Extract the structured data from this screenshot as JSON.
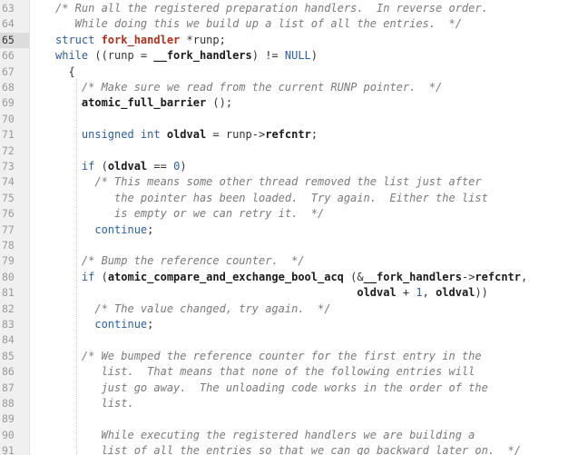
{
  "editor": {
    "lines": [
      {
        "num": "63",
        "current": false,
        "indent": 0,
        "tokens": [
          {
            "t": "/* Run all the registered preparation handlers.  In reverse order.",
            "k": "comment"
          }
        ]
      },
      {
        "num": "64",
        "current": false,
        "indent": 0,
        "tokens": [
          {
            "t": "   While doing this we build up a list of all the entries.  */",
            "k": "comment"
          }
        ]
      },
      {
        "num": "65",
        "current": true,
        "indent": 0,
        "tokens": [
          {
            "t": "struct ",
            "k": "keyword"
          },
          {
            "t": "fork_handler",
            "k": "highlight"
          },
          {
            "t": " *runp;",
            "k": "plain"
          }
        ]
      },
      {
        "num": "66",
        "current": false,
        "indent": 0,
        "tokens": [
          {
            "t": "while",
            "k": "keyword"
          },
          {
            "t": " ((runp = ",
            "k": "plain"
          },
          {
            "t": "__fork_handlers",
            "k": "ident"
          },
          {
            "t": ") != ",
            "k": "plain"
          },
          {
            "t": "NULL",
            "k": "const"
          },
          {
            "t": ")",
            "k": "plain"
          }
        ]
      },
      {
        "num": "67",
        "current": false,
        "indent": 0,
        "tokens": [
          {
            "t": "  {",
            "k": "plain"
          }
        ]
      },
      {
        "num": "68",
        "current": false,
        "indent": 0,
        "tokens": [
          {
            "t": "    /* Make sure we read from the current RUNP pointer.  */",
            "k": "comment"
          }
        ]
      },
      {
        "num": "69",
        "current": false,
        "indent": 0,
        "tokens": [
          {
            "t": "    ",
            "k": "plain"
          },
          {
            "t": "atomic_full_barrier",
            "k": "ident"
          },
          {
            "t": " ();",
            "k": "plain"
          }
        ]
      },
      {
        "num": "70",
        "current": false,
        "indent": 0,
        "tokens": []
      },
      {
        "num": "71",
        "current": false,
        "indent": 0,
        "tokens": [
          {
            "t": "    ",
            "k": "plain"
          },
          {
            "t": "unsigned int",
            "k": "keyword"
          },
          {
            "t": " ",
            "k": "plain"
          },
          {
            "t": "oldval",
            "k": "ident"
          },
          {
            "t": " = runp->",
            "k": "plain"
          },
          {
            "t": "refcntr",
            "k": "ident"
          },
          {
            "t": ";",
            "k": "plain"
          }
        ]
      },
      {
        "num": "72",
        "current": false,
        "indent": 0,
        "tokens": []
      },
      {
        "num": "73",
        "current": false,
        "indent": 0,
        "tokens": [
          {
            "t": "    ",
            "k": "plain"
          },
          {
            "t": "if",
            "k": "keyword"
          },
          {
            "t": " (",
            "k": "plain"
          },
          {
            "t": "oldval",
            "k": "ident"
          },
          {
            "t": " == ",
            "k": "plain"
          },
          {
            "t": "0",
            "k": "num"
          },
          {
            "t": ")",
            "k": "plain"
          }
        ]
      },
      {
        "num": "74",
        "current": false,
        "indent": 0,
        "tokens": [
          {
            "t": "      /* This means some other thread removed the list just after",
            "k": "comment"
          }
        ]
      },
      {
        "num": "75",
        "current": false,
        "indent": 0,
        "tokens": [
          {
            "t": "         the pointer has been loaded.  Try again.  Either the list",
            "k": "comment"
          }
        ]
      },
      {
        "num": "76",
        "current": false,
        "indent": 0,
        "tokens": [
          {
            "t": "         is empty or we can retry it.  */",
            "k": "comment"
          }
        ]
      },
      {
        "num": "77",
        "current": false,
        "indent": 0,
        "tokens": [
          {
            "t": "      ",
            "k": "plain"
          },
          {
            "t": "continue",
            "k": "keyword"
          },
          {
            "t": ";",
            "k": "plain"
          }
        ]
      },
      {
        "num": "78",
        "current": false,
        "indent": 0,
        "tokens": []
      },
      {
        "num": "79",
        "current": false,
        "indent": 0,
        "tokens": [
          {
            "t": "    /* Bump the reference counter.  */",
            "k": "comment"
          }
        ]
      },
      {
        "num": "80",
        "current": false,
        "indent": 0,
        "tokens": [
          {
            "t": "    ",
            "k": "plain"
          },
          {
            "t": "if",
            "k": "keyword"
          },
          {
            "t": " (",
            "k": "plain"
          },
          {
            "t": "atomic_compare_and_exchange_bool_acq",
            "k": "ident"
          },
          {
            "t": " (&",
            "k": "plain"
          },
          {
            "t": "__fork_handlers",
            "k": "ident"
          },
          {
            "t": "->",
            "k": "plain"
          },
          {
            "t": "refcntr",
            "k": "ident"
          },
          {
            "t": ",",
            "k": "plain"
          }
        ]
      },
      {
        "num": "81",
        "current": false,
        "indent": 0,
        "tokens": [
          {
            "t": "                                              ",
            "k": "plain"
          },
          {
            "t": "oldval",
            "k": "ident"
          },
          {
            "t": " + ",
            "k": "plain"
          },
          {
            "t": "1",
            "k": "num"
          },
          {
            "t": ", ",
            "k": "plain"
          },
          {
            "t": "oldval",
            "k": "ident"
          },
          {
            "t": "))",
            "k": "plain"
          }
        ]
      },
      {
        "num": "82",
        "current": false,
        "indent": 0,
        "tokens": [
          {
            "t": "      /* The value changed, try again.  */",
            "k": "comment"
          }
        ]
      },
      {
        "num": "83",
        "current": false,
        "indent": 0,
        "tokens": [
          {
            "t": "      ",
            "k": "plain"
          },
          {
            "t": "continue",
            "k": "keyword"
          },
          {
            "t": ";",
            "k": "plain"
          }
        ]
      },
      {
        "num": "84",
        "current": false,
        "indent": 0,
        "tokens": []
      },
      {
        "num": "85",
        "current": false,
        "indent": 0,
        "tokens": [
          {
            "t": "    /* We bumped the reference counter for the first entry in the",
            "k": "comment"
          }
        ]
      },
      {
        "num": "86",
        "current": false,
        "indent": 0,
        "tokens": [
          {
            "t": "       list.  That means that none of the following entries will",
            "k": "comment"
          }
        ]
      },
      {
        "num": "87",
        "current": false,
        "indent": 0,
        "tokens": [
          {
            "t": "       just go away.  The unloading code works in the order of the",
            "k": "comment"
          }
        ]
      },
      {
        "num": "88",
        "current": false,
        "indent": 0,
        "tokens": [
          {
            "t": "       list.",
            "k": "comment"
          }
        ]
      },
      {
        "num": "89",
        "current": false,
        "indent": 0,
        "tokens": []
      },
      {
        "num": "90",
        "current": false,
        "indent": 0,
        "tokens": [
          {
            "t": "       While executing the registered handlers we are building a",
            "k": "comment"
          }
        ]
      },
      {
        "num": "91",
        "current": false,
        "indent": 0,
        "tokens": [
          {
            "t": "       list of all the entries so that we can go backward later on.  */",
            "k": "comment"
          }
        ]
      }
    ]
  },
  "colors": {
    "gutter_bg": "#f0f0f0",
    "current_line_bg": "#dcdcdc",
    "comment": "#7a7a7a",
    "keyword": "#2a5fa8",
    "highlight": "#b0301a"
  }
}
